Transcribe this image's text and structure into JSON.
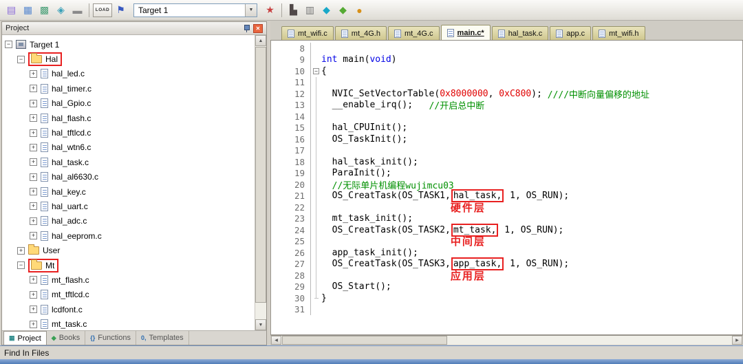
{
  "toolbar": {
    "target_label": "Target 1",
    "items": [
      {
        "kind": "icon",
        "name": "translate-file-icon",
        "glyph": "▤",
        "color": "#8a6ad8"
      },
      {
        "kind": "icon",
        "name": "build-target-icon",
        "glyph": "▦",
        "color": "#5a8ad0"
      },
      {
        "kind": "icon",
        "name": "rebuild-all-icon",
        "glyph": "▩",
        "color": "#4aa078"
      },
      {
        "kind": "icon",
        "name": "batch-build-icon",
        "glyph": "◈",
        "color": "#38a0b8"
      },
      {
        "kind": "icon",
        "name": "stop-build-icon",
        "glyph": "▬",
        "color": "#8a8a8a"
      },
      {
        "kind": "sep"
      },
      {
        "kind": "load",
        "name": "download-to-flash-icon",
        "glyph": "LOAD"
      },
      {
        "kind": "icon",
        "name": "debug-flag-icon",
        "glyph": "⚑",
        "color": "#3858c0"
      },
      {
        "kind": "combo"
      },
      {
        "kind": "icon",
        "name": "options-for-target-icon",
        "glyph": "★",
        "color": "#c84040"
      },
      {
        "kind": "sep"
      },
      {
        "kind": "icon",
        "name": "manage-project-items-icon",
        "glyph": "▙",
        "color": "#504848"
      },
      {
        "kind": "icon",
        "name": "file-extensions-icon",
        "glyph": "▥",
        "color": "#787878"
      },
      {
        "kind": "icon",
        "name": "books-window-icon",
        "glyph": "◆",
        "color": "#18a8c8"
      },
      {
        "kind": "icon",
        "name": "functions-window-icon",
        "glyph": "◆",
        "color": "#55aa33"
      },
      {
        "kind": "icon",
        "name": "templates-window-icon",
        "glyph": "●",
        "color": "#d89018"
      }
    ]
  },
  "project_panel": {
    "title": "Project",
    "bottom_tabs": [
      {
        "label": "Project",
        "glyph": "▦",
        "color": "#2e8b8b",
        "active": true,
        "icon_name": "project-tab-icon"
      },
      {
        "label": "Books",
        "glyph": "◆",
        "color": "#3aa055",
        "active": false,
        "icon_name": "books-tab-icon"
      },
      {
        "label": "Functions",
        "glyph": "{}",
        "color": "#2e6db0",
        "active": false,
        "icon_name": "functions-tab-icon"
      },
      {
        "label": "Templates",
        "glyph": "0,",
        "color": "#2e6db0",
        "active": false,
        "icon_name": "templates-tab-icon"
      }
    ],
    "tree": [
      {
        "label": "Target 1",
        "type": "target",
        "expand": "minus",
        "level": 0,
        "boxed": false
      },
      {
        "label": "Hal",
        "type": "folder",
        "expand": "minus",
        "level": 1,
        "boxed": true
      },
      {
        "label": "hal_led.c",
        "type": "file",
        "expand": "plus",
        "level": 2,
        "boxed": false
      },
      {
        "label": "hal_timer.c",
        "type": "file",
        "expand": "plus",
        "level": 2,
        "boxed": false
      },
      {
        "label": "hal_Gpio.c",
        "type": "file",
        "expand": "plus",
        "level": 2,
        "boxed": false
      },
      {
        "label": "hal_flash.c",
        "type": "file",
        "expand": "plus",
        "level": 2,
        "boxed": false
      },
      {
        "label": "hal_tftlcd.c",
        "type": "file",
        "expand": "plus",
        "level": 2,
        "boxed": false
      },
      {
        "label": "hal_wtn6.c",
        "type": "file",
        "expand": "plus",
        "level": 2,
        "boxed": false
      },
      {
        "label": "hal_task.c",
        "type": "file",
        "expand": "plus",
        "level": 2,
        "boxed": false
      },
      {
        "label": "hal_al6630.c",
        "type": "file",
        "expand": "plus",
        "level": 2,
        "boxed": false
      },
      {
        "label": "hal_key.c",
        "type": "file",
        "expand": "plus",
        "level": 2,
        "boxed": false
      },
      {
        "label": "hal_uart.c",
        "type": "file",
        "expand": "plus",
        "level": 2,
        "boxed": false
      },
      {
        "label": "hal_adc.c",
        "type": "file",
        "expand": "plus",
        "level": 2,
        "boxed": false
      },
      {
        "label": "hal_eeprom.c",
        "type": "file",
        "expand": "plus",
        "level": 2,
        "boxed": false
      },
      {
        "label": "User",
        "type": "folder",
        "expand": "plus",
        "level": 1,
        "boxed": false
      },
      {
        "label": "Mt",
        "type": "folder",
        "expand": "minus",
        "level": 1,
        "boxed": true
      },
      {
        "label": "mt_flash.c",
        "type": "file",
        "expand": "plus",
        "level": 2,
        "boxed": false
      },
      {
        "label": "mt_tftlcd.c",
        "type": "file",
        "expand": "plus",
        "level": 2,
        "boxed": false
      },
      {
        "label": "lcdfont.c",
        "type": "file",
        "expand": "plus",
        "level": 2,
        "boxed": false
      },
      {
        "label": "mt_task.c",
        "type": "file",
        "expand": "plus",
        "level": 2,
        "boxed": false
      }
    ]
  },
  "editor": {
    "tabs": [
      {
        "label": "mt_wifi.c",
        "active": false
      },
      {
        "label": "mt_4G.h",
        "active": false
      },
      {
        "label": "mt_4G.c",
        "active": false
      },
      {
        "label": "main.c*",
        "active": true
      },
      {
        "label": "hal_task.c",
        "active": false
      },
      {
        "label": "app.c",
        "active": false
      },
      {
        "label": "mt_wifi.h",
        "active": false
      }
    ],
    "code": [
      {
        "n": 8,
        "fold": "",
        "tokens": []
      },
      {
        "n": 9,
        "fold": "",
        "tokens": [
          {
            "t": "int",
            "c": "kw"
          },
          {
            "t": " main(",
            "c": "p"
          },
          {
            "t": "void",
            "c": "kw"
          },
          {
            "t": ")",
            "c": "p"
          }
        ]
      },
      {
        "n": 10,
        "fold": "box",
        "tokens": [
          {
            "t": "{",
            "c": "p"
          }
        ]
      },
      {
        "n": 11,
        "fold": "line",
        "tokens": []
      },
      {
        "n": 12,
        "fold": "line",
        "tokens": [
          {
            "t": "  NVIC_SetVectorTable(",
            "c": "p"
          },
          {
            "t": "0x8000000",
            "c": "num"
          },
          {
            "t": ", ",
            "c": "p"
          },
          {
            "t": "0xC800",
            "c": "num"
          },
          {
            "t": "); ",
            "c": "p"
          },
          {
            "t": "////中断向量偏移的地址",
            "c": "cmt"
          }
        ]
      },
      {
        "n": 13,
        "fold": "line",
        "tokens": [
          {
            "t": "  __enable_irq();   ",
            "c": "p"
          },
          {
            "t": "//开启总中断",
            "c": "cmt"
          }
        ]
      },
      {
        "n": 14,
        "fold": "line",
        "tokens": []
      },
      {
        "n": 15,
        "fold": "line",
        "tokens": [
          {
            "t": "  hal_CPUInit();",
            "c": "p"
          }
        ]
      },
      {
        "n": 16,
        "fold": "line",
        "tokens": [
          {
            "t": "  OS_TaskInit();",
            "c": "p"
          }
        ]
      },
      {
        "n": 17,
        "fold": "line",
        "tokens": []
      },
      {
        "n": 18,
        "fold": "line",
        "tokens": [
          {
            "t": "  hal_task_init();",
            "c": "p"
          }
        ]
      },
      {
        "n": 19,
        "fold": "line",
        "tokens": [
          {
            "t": "  ParaInit();",
            "c": "p"
          }
        ]
      },
      {
        "n": 20,
        "fold": "line",
        "tokens": [
          {
            "t": "  //无际单片机编程wujimcu03",
            "c": "cmt"
          }
        ]
      },
      {
        "n": 21,
        "fold": "line",
        "tokens": [
          {
            "t": "  OS_CreatTask(OS_TASK1,",
            "c": "p"
          },
          {
            "t": "hal_task,",
            "c": "box"
          },
          {
            "t": " 1, OS_RUN);",
            "c": "p"
          }
        ]
      },
      {
        "n": 22,
        "fold": "line",
        "tokens": [
          {
            "t": "                        ",
            "c": "p"
          },
          {
            "t": "硬件层",
            "c": "annot"
          }
        ]
      },
      {
        "n": 23,
        "fold": "line",
        "tokens": [
          {
            "t": "  mt_task_init();",
            "c": "p"
          }
        ]
      },
      {
        "n": 24,
        "fold": "line",
        "tokens": [
          {
            "t": "  OS_CreatTask(OS_TASK2,",
            "c": "p"
          },
          {
            "t": "mt_task,",
            "c": "box"
          },
          {
            "t": " 1, OS_RUN);",
            "c": "p"
          }
        ]
      },
      {
        "n": 25,
        "fold": "line",
        "tokens": [
          {
            "t": "                        ",
            "c": "p"
          },
          {
            "t": "中间层",
            "c": "annot"
          }
        ]
      },
      {
        "n": 26,
        "fold": "line",
        "tokens": [
          {
            "t": "  app_task_init();",
            "c": "p"
          }
        ]
      },
      {
        "n": 27,
        "fold": "line",
        "tokens": [
          {
            "t": "  OS_CreatTask(OS_TASK3,",
            "c": "p"
          },
          {
            "t": "app_task,",
            "c": "box"
          },
          {
            "t": " 1, OS_RUN);",
            "c": "p"
          }
        ]
      },
      {
        "n": 28,
        "fold": "line",
        "tokens": [
          {
            "t": "                        ",
            "c": "p"
          },
          {
            "t": "应用层",
            "c": "annot"
          }
        ]
      },
      {
        "n": 29,
        "fold": "line",
        "tokens": [
          {
            "t": "  OS_Start();",
            "c": "p"
          }
        ]
      },
      {
        "n": 30,
        "fold": "end",
        "tokens": [
          {
            "t": "}",
            "c": "p"
          }
        ]
      },
      {
        "n": 31,
        "fold": "",
        "tokens": []
      }
    ]
  },
  "statusbar": {
    "text": "Find In Files"
  },
  "colors": {
    "keyword": "#0000e6",
    "comment": "#009000",
    "number": "#e00000",
    "annotation_red": "#e82020",
    "tab_inactive": "#d6cf99",
    "tab_active": "#fcfcf2"
  }
}
